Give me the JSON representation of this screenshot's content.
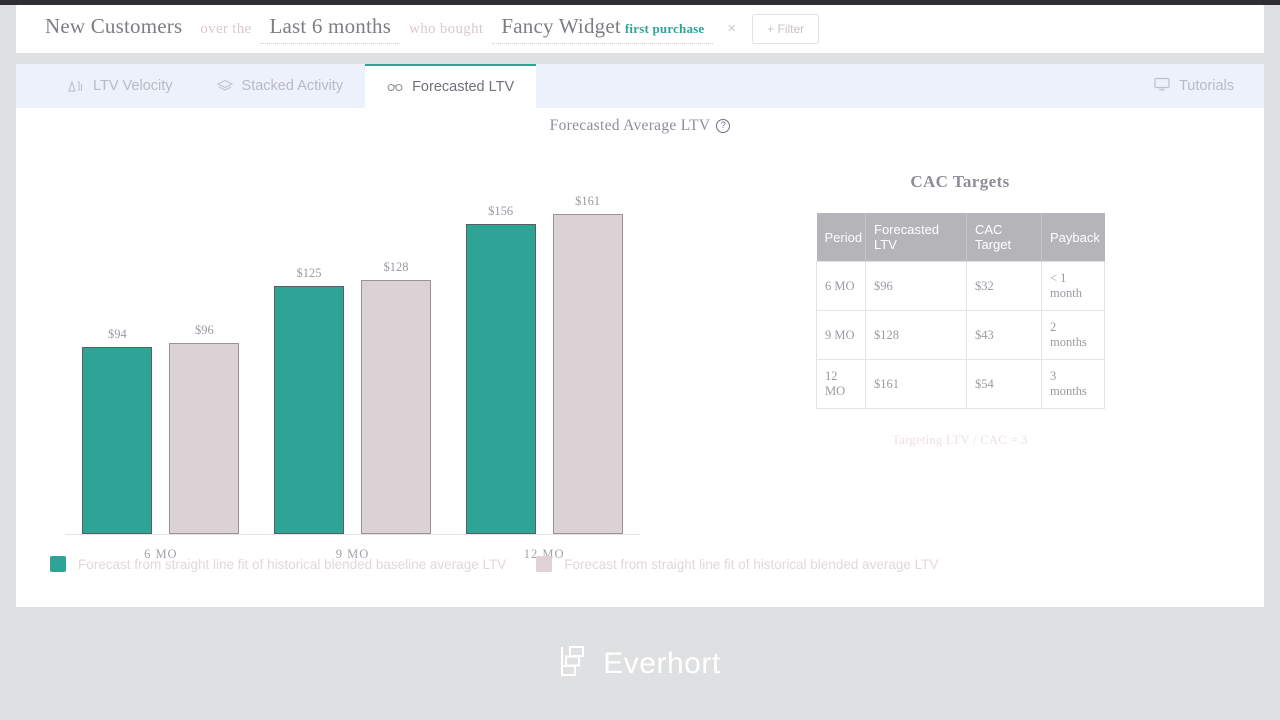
{
  "query_bar": {
    "segments": [
      {
        "text": "New Customers",
        "kind": "entity"
      },
      {
        "text": "over the",
        "kind": "connector"
      },
      {
        "text": "Last 6 months",
        "kind": "entity-editable"
      },
      {
        "text": "who bought",
        "kind": "connector"
      },
      {
        "text": "Fancy Widget",
        "kind": "entity-editable"
      }
    ],
    "tag": "first purchase",
    "remove_icon": "×",
    "filter_button": "+ Filter"
  },
  "tabs": [
    {
      "label": "LTV Velocity",
      "icon": "velocity-chart-icon",
      "active": false
    },
    {
      "label": "Stacked Activity",
      "icon": "layers-icon",
      "active": false
    },
    {
      "label": "Forecasted LTV",
      "icon": "binoculars-icon",
      "active": true
    }
  ],
  "tutorials": {
    "label": "Tutorials",
    "icon": "monitor-icon"
  },
  "panel": {
    "title": "Forecasted Average LTV",
    "help_icon": "?"
  },
  "chart_data": {
    "type": "bar",
    "title": "Forecasted Average LTV",
    "categories": [
      "6 MO",
      "9 MO",
      "12 MO"
    ],
    "xlabel": "",
    "ylabel": "",
    "ylim": [
      0,
      200
    ],
    "grid": false,
    "legend_position": "bottom",
    "series": [
      {
        "name": "Forecast from straight line fit of historical blended baseline average LTV",
        "color": "#2fa396",
        "values": [
          94,
          125,
          156
        ],
        "value_labels": [
          "$94",
          "$125",
          "$156"
        ]
      },
      {
        "name": "Forecast from straight line fit of historical blended average LTV",
        "color": "#dcd1d4",
        "values": [
          96,
          128,
          161
        ],
        "value_labels": [
          "$96",
          "$128",
          "$161"
        ]
      }
    ]
  },
  "cac": {
    "title": "CAC Targets",
    "columns": [
      "Period",
      "Forecasted LTV",
      "CAC Target",
      "Payback"
    ],
    "rows": [
      [
        "6 MO",
        "$96",
        "$32",
        "< 1 month"
      ],
      [
        "9 MO",
        "$128",
        "$43",
        "2 months"
      ],
      [
        "12 MO",
        "$161",
        "$54",
        "3 months"
      ]
    ],
    "note": "Targeting LTV / CAC = 3"
  },
  "footer": {
    "brand": "Everhort",
    "logo_icon": "stacked-blocks-icon"
  },
  "colors": {
    "teal": "#2fa396",
    "pink": "#dcd1d4",
    "tab_bar_bg": "#edf1fc",
    "page_bg": "#dfe0e2"
  }
}
